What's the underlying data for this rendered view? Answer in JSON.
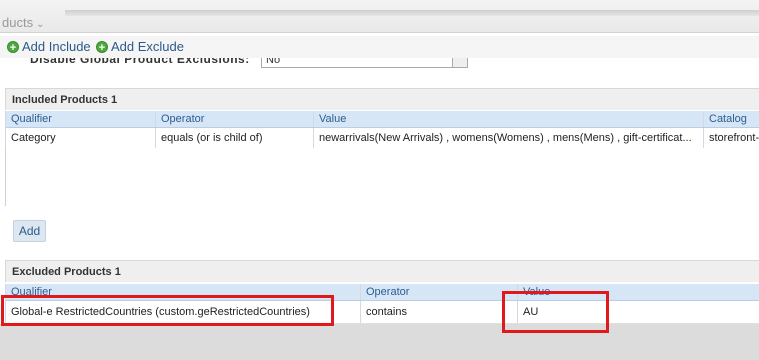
{
  "breadcrumb": {
    "text": "ducts"
  },
  "toolbar": {
    "add_include": "Add Include",
    "add_exclude": "Add Exclude"
  },
  "background_field": {
    "label": "Disable Global Product Exclusions:",
    "value": "No"
  },
  "included": {
    "title": "Included Products 1",
    "columns": [
      "Qualifier",
      "Operator",
      "Value",
      "Catalog"
    ],
    "rows": [
      {
        "qualifier": "Category",
        "operator": "equals (or is child of)",
        "value": "newarrivals(New Arrivals) , womens(Womens) , mens(Mens) , gift-certificat...",
        "catalog": "storefront-c"
      }
    ],
    "add_label": "Add"
  },
  "excluded": {
    "title": "Excluded Products 1",
    "columns": [
      "Qualifier",
      "Operator",
      "Value"
    ],
    "rows": [
      {
        "qualifier": "Global-e RestrictedCountries (custom.geRestrictedCountries)",
        "operator": "contains",
        "value": "AU"
      }
    ]
  },
  "colors": {
    "header_bg": "#d6e6f7",
    "header_text": "#2c5d8f",
    "highlight": "#e0191c",
    "add_icon": "#4caa3c"
  }
}
